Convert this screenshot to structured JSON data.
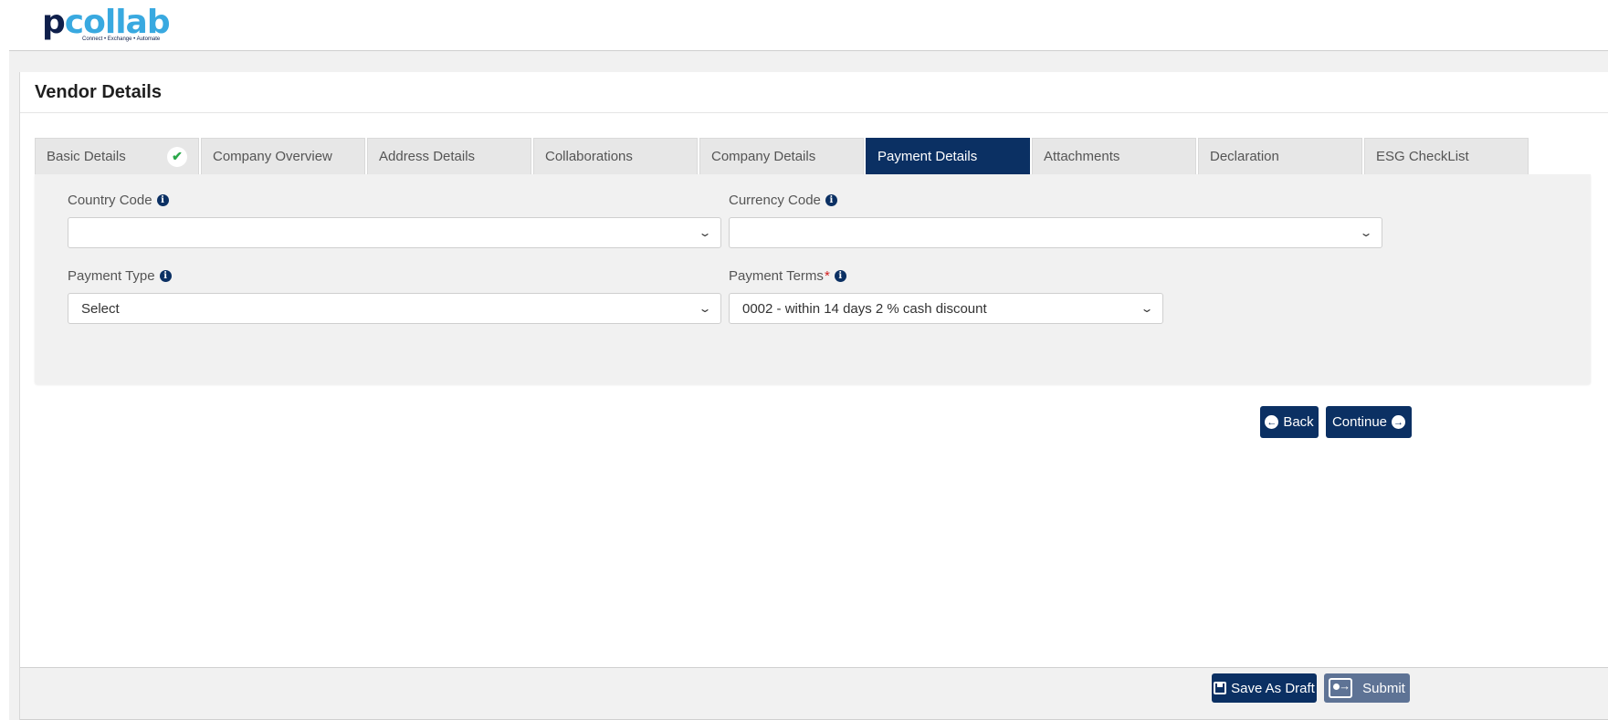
{
  "brand": {
    "logo_p": "p",
    "logo_rest": "collab",
    "tagline": "Connect • Exchange • Automate"
  },
  "page": {
    "title": "Vendor Details"
  },
  "tabs": [
    {
      "label": "Basic Details",
      "completed": true
    },
    {
      "label": "Company Overview"
    },
    {
      "label": "Address Details"
    },
    {
      "label": "Collaborations"
    },
    {
      "label": "Company Details"
    },
    {
      "label": "Payment Details",
      "active": true
    },
    {
      "label": "Attachments"
    },
    {
      "label": "Declaration"
    },
    {
      "label": "ESG CheckList"
    }
  ],
  "form": {
    "country_code": {
      "label": "Country Code",
      "value": ""
    },
    "currency_code": {
      "label": "Currency Code",
      "value": ""
    },
    "payment_type": {
      "label": "Payment Type",
      "value": "Select"
    },
    "payment_terms": {
      "label": "Payment Terms",
      "required_mark": "*",
      "value": "0002 - within 14 days 2 % cash discount"
    }
  },
  "nav_buttons": {
    "back": "Back",
    "continue": "Continue"
  },
  "footer": {
    "save_draft": "Save As Draft",
    "submit": "Submit"
  },
  "colors": {
    "primary": "#0b3063",
    "accent": "#39a9e0",
    "disabled_button": "#5e7395",
    "check": "#2aa74a",
    "required": "#d21f1f"
  }
}
